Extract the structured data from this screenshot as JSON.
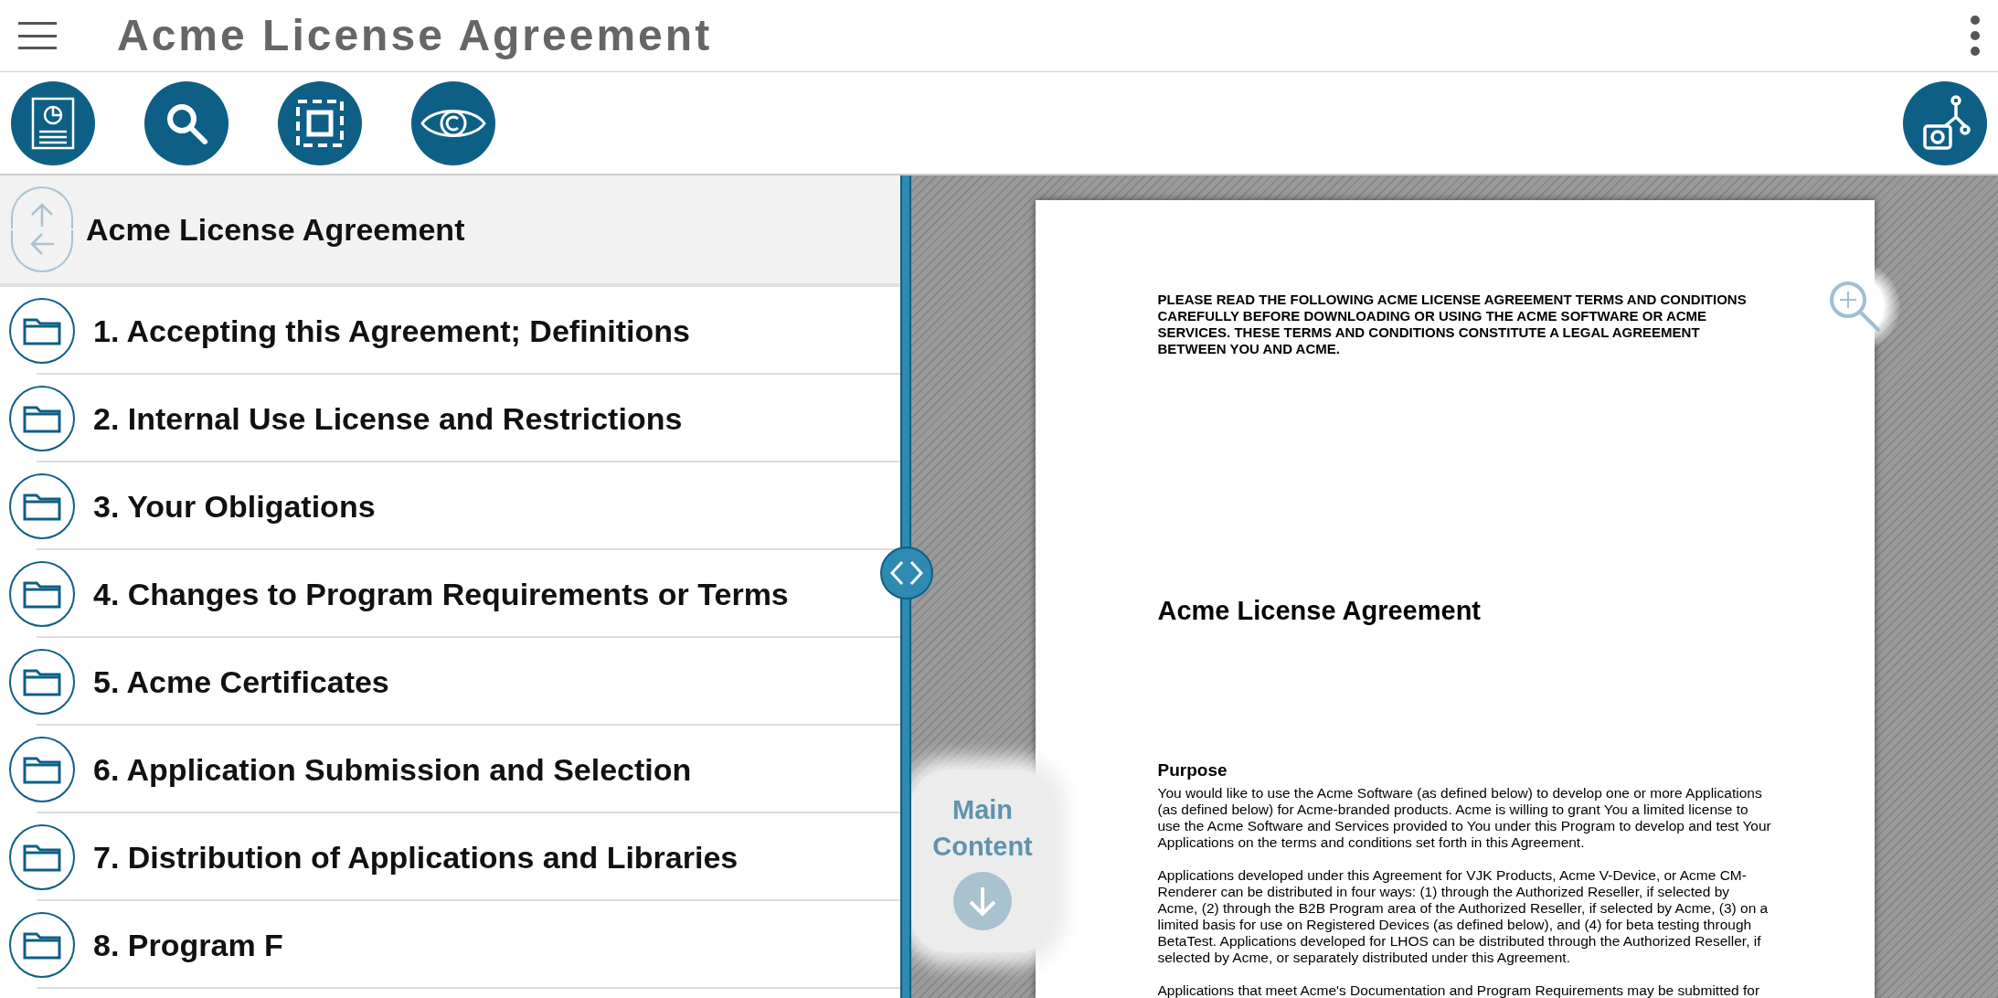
{
  "app_bar": {
    "title": "Acme License Agreement"
  },
  "nav": {
    "title": "Acme License Agreement",
    "items": [
      {
        "label": "1. Accepting this Agreement; Definitions"
      },
      {
        "label": "2. Internal Use License and Restrictions"
      },
      {
        "label": "3. Your Obligations"
      },
      {
        "label": "4. Changes to Program Requirements or Terms"
      },
      {
        "label": "5. Acme Certificates"
      },
      {
        "label": "6. Application Submission and Selection"
      },
      {
        "label": "7. Distribution of Applications and Libraries"
      },
      {
        "label": "8. Program F"
      }
    ]
  },
  "skip_link": {
    "label": "Main Content"
  },
  "document": {
    "notice": "PLEASE READ THE FOLLOWING ACME LICENSE AGREEMENT TERMS AND CONDITIONS CAREFULLY BEFORE DOWNLOADING OR USING THE ACME SOFTWARE OR ACME SERVICES.  THESE TERMS AND CONDITIONS CONSTITUTE A LEGAL AGREEMENT BETWEEN YOU AND ACME.",
    "title": "Acme License Agreement",
    "section_heading": "Purpose",
    "paragraphs": [
      "You would like to use the Acme Software (as defined below) to develop one or more Applications (as defined below) for Acme-branded products.  Acme is willing to grant You a limited license to use the Acme Software and Services provided to You under this Program to develop and test Your Applications on the terms and conditions set forth in this Agreement.",
      "Applications developed under this Agreement for VJK Products, Acme V-Device, or Acme CM-Renderer can be distributed in four ways: (1) through the Authorized Reseller, if selected by Acme, (2) through the B2B Program area of the Authorized Reseller, if selected by Acme, (3) on a limited basis for use on Registered Devices (as defined below), and (4) for beta testing through BetaTest.  Applications developed for LHOS can be distributed through the Authorized Reseller, if selected by Acme, or separately distributed under this Agreement.",
      "Applications that meet Acme's Documentation and Program Requirements may be submitted for"
    ]
  }
}
